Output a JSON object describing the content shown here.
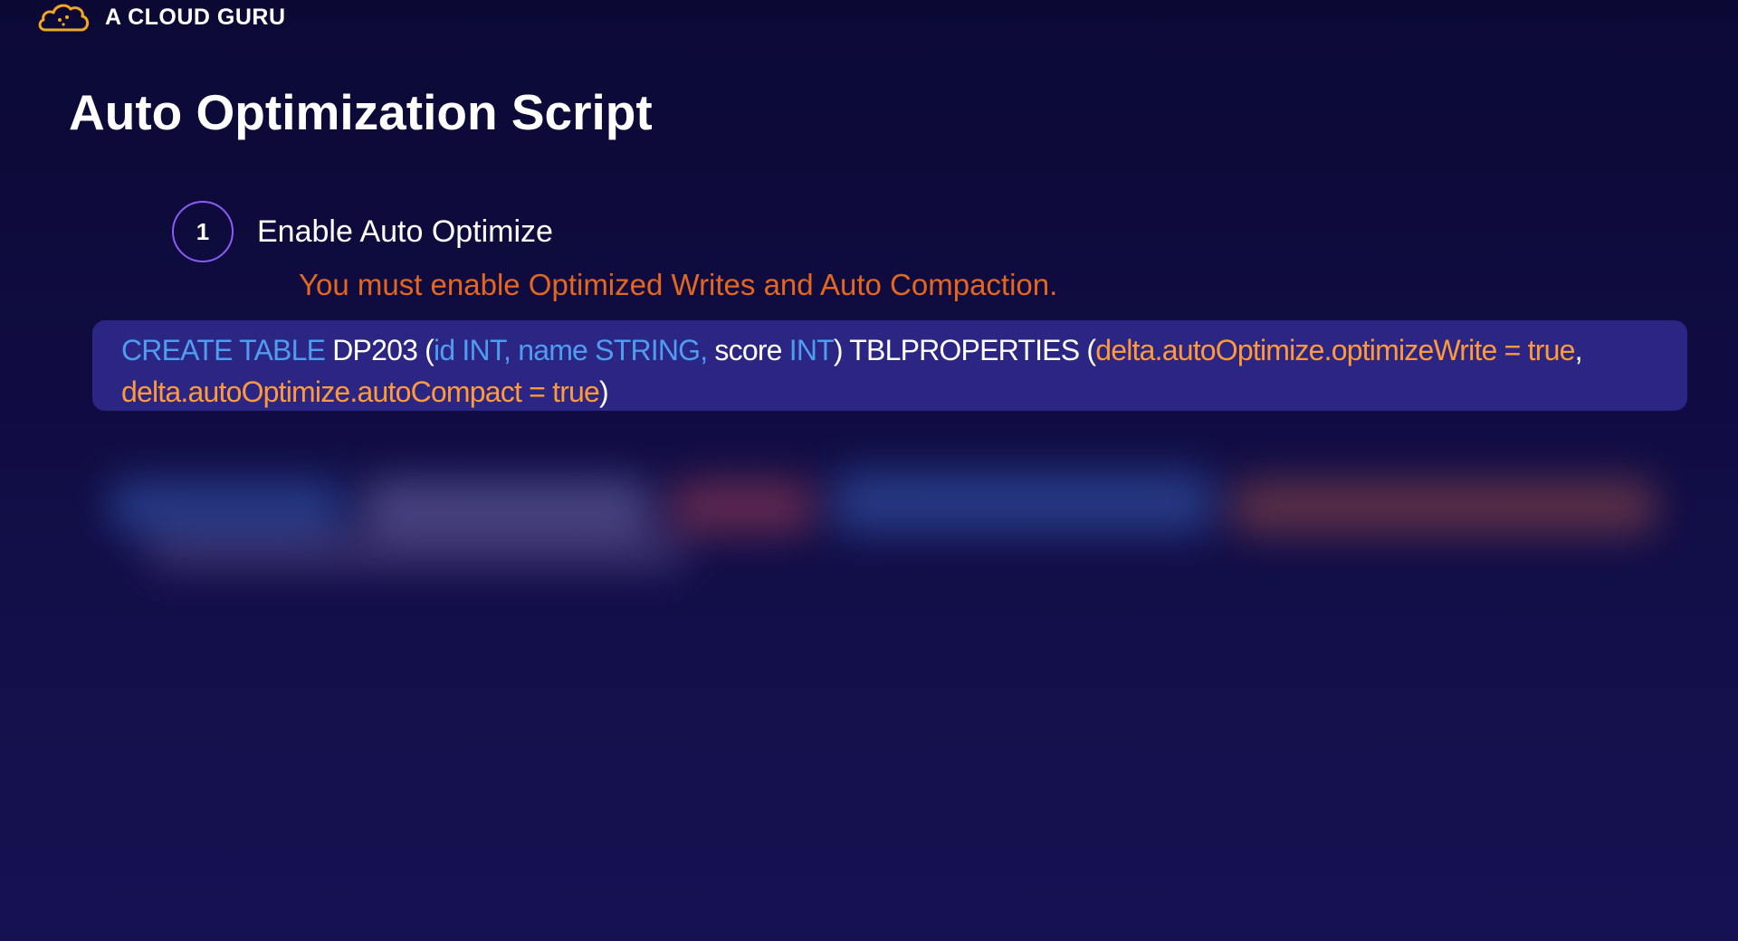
{
  "brand": {
    "name": "A CLOUD GURU",
    "logo_icon": "cloud-logo-icon",
    "logo_color": "#f5a623"
  },
  "slide": {
    "title": "Auto Optimization Script",
    "step": {
      "number": "1",
      "label": "Enable Auto Optimize"
    },
    "note": "You must enable Optimized Writes and Auto Compaction.",
    "code": {
      "line1": [
        {
          "text": "CREATE TABLE ",
          "color": "#4f9cf0"
        },
        {
          "text": "DP203 (",
          "color": "#ffffff"
        },
        {
          "text": "id INT, name STRING, ",
          "color": "#4f9cf0"
        },
        {
          "text": "score ",
          "color": "#ffffff"
        },
        {
          "text": "INT",
          "color": "#4f9cf0"
        },
        {
          "text": ") TBLPROPERTIES (",
          "color": "#ffffff"
        },
        {
          "text": "delta.autoOptimize.optimizeWrite = true",
          "color": "#ff9a3c"
        },
        {
          "text": ",",
          "color": "#ffffff"
        }
      ],
      "line2": [
        {
          "text": "delta.autoOptimize.autoCompact = true",
          "color": "#ff9a3c"
        },
        {
          "text": ")",
          "color": "#ffffff"
        }
      ]
    }
  },
  "colors": {
    "background": "#100c42",
    "accent_purple": "#8b5cf6",
    "note_orange": "#e5661f",
    "code_bg": "#2b2583",
    "keyword_blue": "#4f9cf0",
    "value_orange": "#ff9a3c"
  }
}
